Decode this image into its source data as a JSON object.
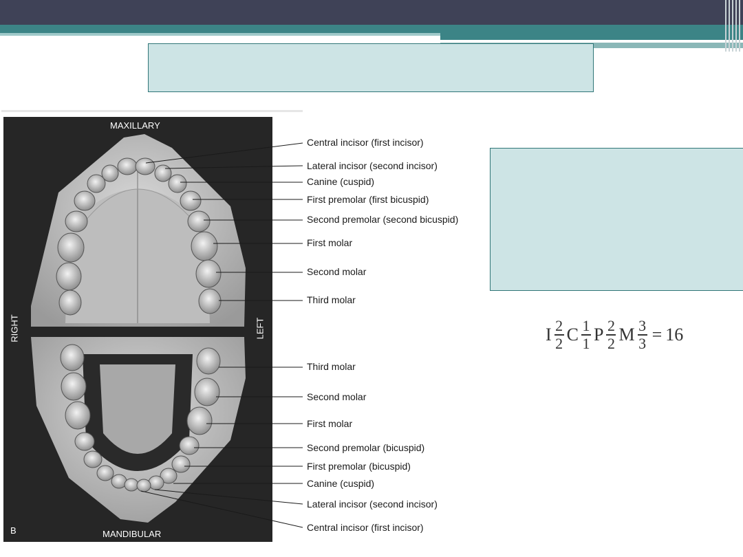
{
  "slide": {
    "title": "",
    "content": ""
  },
  "photo": {
    "top_label": "MAXILLARY",
    "bottom_label": "MANDIBULAR",
    "right_side": "RIGHT",
    "left_side": "LEFT",
    "panel_letter": "B"
  },
  "maxillary_labels": [
    "Central incisor (first incisor)",
    "Lateral incisor (second incisor)",
    "Canine (cuspid)",
    "First premolar (first bicuspid)",
    "Second premolar (second bicuspid)",
    "First molar",
    "Second molar",
    "Third molar"
  ],
  "mandibular_labels": [
    "Third molar",
    "Second molar",
    "First molar",
    "Second premolar (bicuspid)",
    "First premolar (bicuspid)",
    "Canine (cuspid)",
    "Lateral incisor (second incisor)",
    "Central incisor (first incisor)"
  ],
  "formula": {
    "incisor_symbol": "I",
    "incisor_top": "2",
    "incisor_bottom": "2",
    "canine_symbol": "C",
    "canine_top": "1",
    "canine_bottom": "1",
    "premolar_symbol": "P",
    "premolar_top": "2",
    "premolar_bottom": "2",
    "molar_symbol": "M",
    "molar_top": "3",
    "molar_bottom": "3",
    "equals": "=",
    "total": "16"
  },
  "colors": {
    "header_dark": "#3f4257",
    "teal": "#3c8486",
    "box_fill": "#cde4e5",
    "box_border": "#2f7577"
  }
}
